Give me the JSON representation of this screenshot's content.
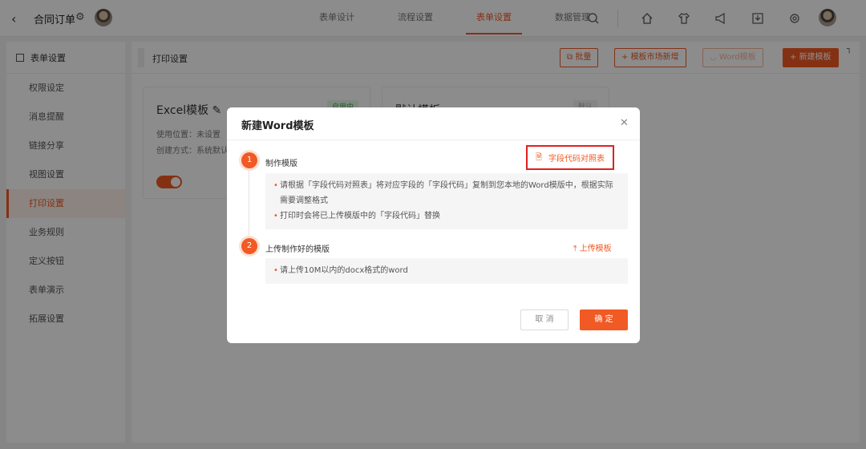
{
  "header": {
    "app_title": "合同订单",
    "tabs": [
      {
        "label": "表单设计"
      },
      {
        "label": "流程设置"
      },
      {
        "label": "表单设置"
      },
      {
        "label": "数据管理"
      }
    ],
    "active_tab": "表单设置",
    "icons": [
      "search-icon",
      "home-icon",
      "shirt-icon",
      "megaphone-icon",
      "download-icon",
      "settings-icon"
    ]
  },
  "sidebar": {
    "title": "表单设置",
    "items": [
      {
        "label": "权限设定"
      },
      {
        "label": "消息提醒"
      },
      {
        "label": "链接分享"
      },
      {
        "label": "视图设置"
      },
      {
        "label": "打印设置"
      },
      {
        "label": "业务规则"
      },
      {
        "label": "定义按钮"
      },
      {
        "label": "表单演示"
      },
      {
        "label": "拓展设置"
      }
    ],
    "active_item": "打印设置"
  },
  "main": {
    "title": "打印设置",
    "buttons": {
      "batch": "批量",
      "market_add": "模板市场新增",
      "word_template": "Word模板",
      "new_template": "新建模板"
    },
    "cards": [
      {
        "title": "Excel模板",
        "badge": "启用中",
        "usage": "使用位置：未设置",
        "creation": "创建方式：系统默认",
        "enabled": true
      },
      {
        "title": "默认模板",
        "badge": "默认"
      }
    ]
  },
  "modal": {
    "title": "新建Word模板",
    "step1": {
      "num": "1",
      "title": "制作模版",
      "link": "字段代码对照表",
      "bullet1": "请根据「字段代码对照表」将对应字段的「字段代码」复制到您本地的Word模版中，根据实际需要调整格式",
      "bullet2": "打印时会将已上传模版中的「字段代码」替换"
    },
    "step2": {
      "num": "2",
      "title": "上传制作好的模版",
      "link": "上传模板",
      "bullet1": "请上传10M以内的docx格式的word"
    },
    "cancel": "取 消",
    "confirm": "确 定"
  },
  "colors": {
    "accent": "#f15a24",
    "highlight_box": "#e02020"
  }
}
